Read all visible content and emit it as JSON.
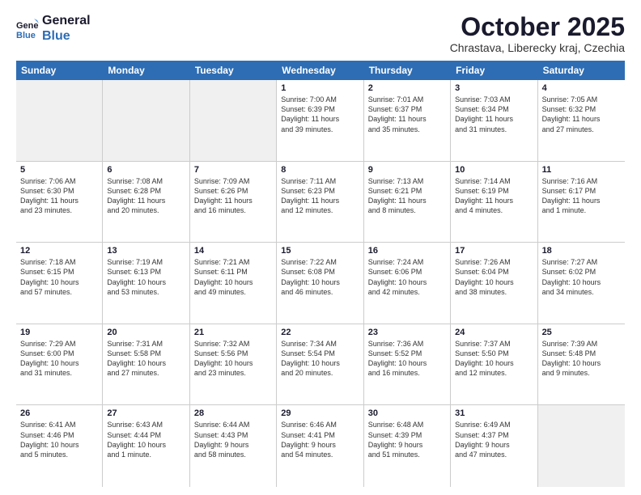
{
  "logo": {
    "line1": "General",
    "line2": "Blue"
  },
  "title": "October 2025",
  "location": "Chrastava, Liberecky kraj, Czechia",
  "header_days": [
    "Sunday",
    "Monday",
    "Tuesday",
    "Wednesday",
    "Thursday",
    "Friday",
    "Saturday"
  ],
  "weeks": [
    [
      {
        "day": "",
        "info": ""
      },
      {
        "day": "",
        "info": ""
      },
      {
        "day": "",
        "info": ""
      },
      {
        "day": "1",
        "info": "Sunrise: 7:00 AM\nSunset: 6:39 PM\nDaylight: 11 hours\nand 39 minutes."
      },
      {
        "day": "2",
        "info": "Sunrise: 7:01 AM\nSunset: 6:37 PM\nDaylight: 11 hours\nand 35 minutes."
      },
      {
        "day": "3",
        "info": "Sunrise: 7:03 AM\nSunset: 6:34 PM\nDaylight: 11 hours\nand 31 minutes."
      },
      {
        "day": "4",
        "info": "Sunrise: 7:05 AM\nSunset: 6:32 PM\nDaylight: 11 hours\nand 27 minutes."
      }
    ],
    [
      {
        "day": "5",
        "info": "Sunrise: 7:06 AM\nSunset: 6:30 PM\nDaylight: 11 hours\nand 23 minutes."
      },
      {
        "day": "6",
        "info": "Sunrise: 7:08 AM\nSunset: 6:28 PM\nDaylight: 11 hours\nand 20 minutes."
      },
      {
        "day": "7",
        "info": "Sunrise: 7:09 AM\nSunset: 6:26 PM\nDaylight: 11 hours\nand 16 minutes."
      },
      {
        "day": "8",
        "info": "Sunrise: 7:11 AM\nSunset: 6:23 PM\nDaylight: 11 hours\nand 12 minutes."
      },
      {
        "day": "9",
        "info": "Sunrise: 7:13 AM\nSunset: 6:21 PM\nDaylight: 11 hours\nand 8 minutes."
      },
      {
        "day": "10",
        "info": "Sunrise: 7:14 AM\nSunset: 6:19 PM\nDaylight: 11 hours\nand 4 minutes."
      },
      {
        "day": "11",
        "info": "Sunrise: 7:16 AM\nSunset: 6:17 PM\nDaylight: 11 hours\nand 1 minute."
      }
    ],
    [
      {
        "day": "12",
        "info": "Sunrise: 7:18 AM\nSunset: 6:15 PM\nDaylight: 10 hours\nand 57 minutes."
      },
      {
        "day": "13",
        "info": "Sunrise: 7:19 AM\nSunset: 6:13 PM\nDaylight: 10 hours\nand 53 minutes."
      },
      {
        "day": "14",
        "info": "Sunrise: 7:21 AM\nSunset: 6:11 PM\nDaylight: 10 hours\nand 49 minutes."
      },
      {
        "day": "15",
        "info": "Sunrise: 7:22 AM\nSunset: 6:08 PM\nDaylight: 10 hours\nand 46 minutes."
      },
      {
        "day": "16",
        "info": "Sunrise: 7:24 AM\nSunset: 6:06 PM\nDaylight: 10 hours\nand 42 minutes."
      },
      {
        "day": "17",
        "info": "Sunrise: 7:26 AM\nSunset: 6:04 PM\nDaylight: 10 hours\nand 38 minutes."
      },
      {
        "day": "18",
        "info": "Sunrise: 7:27 AM\nSunset: 6:02 PM\nDaylight: 10 hours\nand 34 minutes."
      }
    ],
    [
      {
        "day": "19",
        "info": "Sunrise: 7:29 AM\nSunset: 6:00 PM\nDaylight: 10 hours\nand 31 minutes."
      },
      {
        "day": "20",
        "info": "Sunrise: 7:31 AM\nSunset: 5:58 PM\nDaylight: 10 hours\nand 27 minutes."
      },
      {
        "day": "21",
        "info": "Sunrise: 7:32 AM\nSunset: 5:56 PM\nDaylight: 10 hours\nand 23 minutes."
      },
      {
        "day": "22",
        "info": "Sunrise: 7:34 AM\nSunset: 5:54 PM\nDaylight: 10 hours\nand 20 minutes."
      },
      {
        "day": "23",
        "info": "Sunrise: 7:36 AM\nSunset: 5:52 PM\nDaylight: 10 hours\nand 16 minutes."
      },
      {
        "day": "24",
        "info": "Sunrise: 7:37 AM\nSunset: 5:50 PM\nDaylight: 10 hours\nand 12 minutes."
      },
      {
        "day": "25",
        "info": "Sunrise: 7:39 AM\nSunset: 5:48 PM\nDaylight: 10 hours\nand 9 minutes."
      }
    ],
    [
      {
        "day": "26",
        "info": "Sunrise: 6:41 AM\nSunset: 4:46 PM\nDaylight: 10 hours\nand 5 minutes."
      },
      {
        "day": "27",
        "info": "Sunrise: 6:43 AM\nSunset: 4:44 PM\nDaylight: 10 hours\nand 1 minute."
      },
      {
        "day": "28",
        "info": "Sunrise: 6:44 AM\nSunset: 4:43 PM\nDaylight: 9 hours\nand 58 minutes."
      },
      {
        "day": "29",
        "info": "Sunrise: 6:46 AM\nSunset: 4:41 PM\nDaylight: 9 hours\nand 54 minutes."
      },
      {
        "day": "30",
        "info": "Sunrise: 6:48 AM\nSunset: 4:39 PM\nDaylight: 9 hours\nand 51 minutes."
      },
      {
        "day": "31",
        "info": "Sunrise: 6:49 AM\nSunset: 4:37 PM\nDaylight: 9 hours\nand 47 minutes."
      },
      {
        "day": "",
        "info": ""
      }
    ]
  ]
}
